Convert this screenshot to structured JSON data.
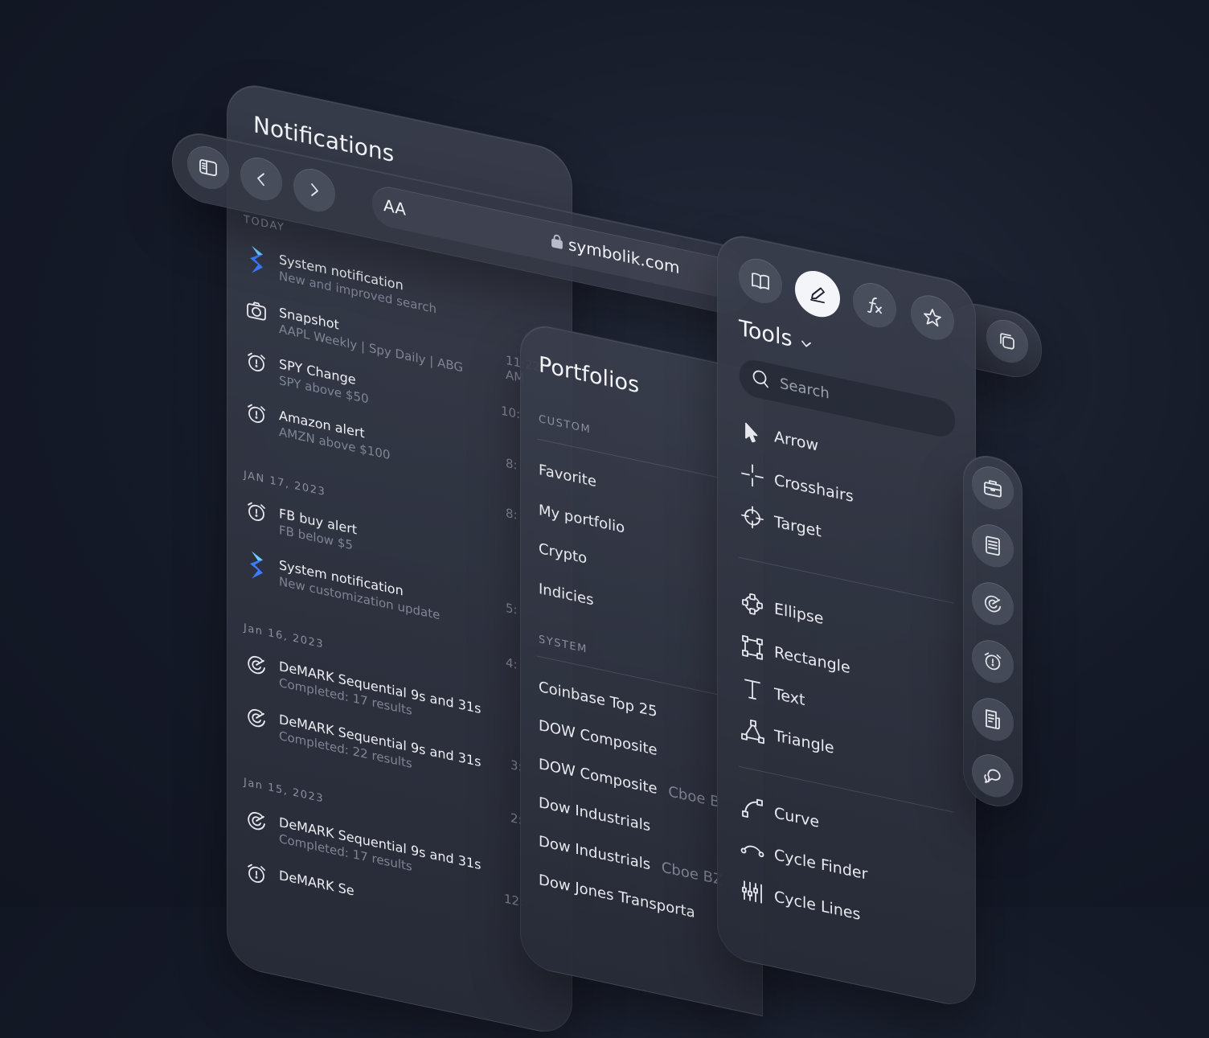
{
  "notifications": {
    "title": "Notifications",
    "groups": [
      {
        "label": "TODAY",
        "items": [
          {
            "title": "System notification",
            "subtitle": "New and improved search",
            "time": "",
            "icon": "symbolik-logo-icon"
          },
          {
            "title": "Snapshot",
            "subtitle": "AAPL Weekly | Spy Daily | ABG",
            "time": "11:22 AM",
            "icon": "camera-icon"
          },
          {
            "title": "SPY Change",
            "subtitle": "SPY above $50",
            "time": "10:",
            "icon": "alarm-icon"
          },
          {
            "title": "Amazon alert",
            "subtitle": "AMZN above $100",
            "time": "8:",
            "icon": "alarm-icon"
          }
        ]
      },
      {
        "label": "JAN 17, 2023",
        "items": [
          {
            "title": "FB buy alert",
            "subtitle": "FB below $5",
            "time": "8:",
            "icon": "alarm-icon"
          },
          {
            "title": "System notification",
            "subtitle": "New customization update",
            "time": "5:",
            "icon": "symbolik-logo-icon"
          }
        ]
      },
      {
        "label": "Jan 16, 2023",
        "items": [
          {
            "title": "DeMARK Sequential 9s and 31s",
            "subtitle": "Completed: 17 results",
            "time": "4:",
            "icon": "demark-icon"
          },
          {
            "title": "DeMARK Sequential 9s and 31s",
            "subtitle": "Completed: 22 results",
            "time": "3:",
            "icon": "demark-icon"
          }
        ]
      },
      {
        "label": "Jan 15, 2023",
        "items": [
          {
            "title": "DeMARK Sequential 9s and 31s",
            "subtitle": "Completed: 17 results",
            "time": "2:",
            "icon": "demark-icon"
          },
          {
            "title": "DeMARK Se",
            "subtitle": "",
            "time": "12:",
            "icon": "alarm-icon"
          }
        ]
      }
    ]
  },
  "browser": {
    "text_size_label": "AA",
    "url": "symbolik.com"
  },
  "portfolios": {
    "title": "Portfolios",
    "custom_label": "CUSTOM",
    "custom_items": [
      "Favorite",
      "My portfolio",
      "Crypto",
      "Indicies"
    ],
    "system_label": "SYSTEM",
    "system_items": [
      {
        "name": "Coinbase Top 25",
        "tag": ""
      },
      {
        "name": "DOW Composite",
        "tag": ""
      },
      {
        "name": "DOW Composite",
        "tag": "Cboe B"
      },
      {
        "name": "Dow Industrials",
        "tag": ""
      },
      {
        "name": "Dow Industrials",
        "tag": "Cboe BZ"
      },
      {
        "name": "Dow Jones Transporta",
        "tag": ""
      }
    ]
  },
  "tools": {
    "title": "Tools",
    "search_placeholder": "Search",
    "groups": [
      [
        "Arrow",
        "Crosshairs",
        "Target"
      ],
      [
        "Ellipse",
        "Rectangle",
        "Text",
        "Triangle"
      ],
      [
        "Curve",
        "Cycle Finder",
        "Cycle Lines"
      ]
    ]
  },
  "icons": {
    "sidebar_toggle": "sidebar-icon",
    "back": "chevron-left-icon",
    "forward": "chevron-right-icon",
    "tabs": "tabs-icon",
    "tool_tabs": [
      "book-icon",
      "pencil-icon",
      "function-icon",
      "star-icon"
    ],
    "right_rail": [
      "briefcase-icon",
      "list-icon",
      "demark-icon",
      "alarm-icon",
      "document-icon",
      "chat-icon"
    ]
  }
}
